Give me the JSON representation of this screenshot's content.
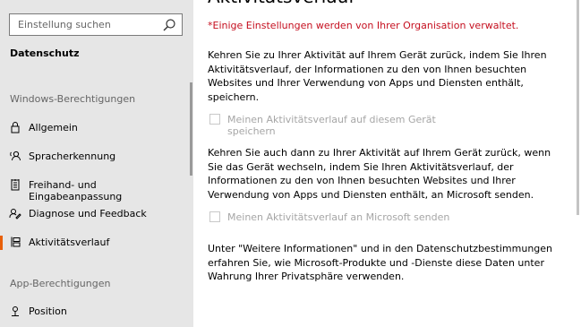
{
  "search": {
    "placeholder": "Einstellung suchen",
    "icon": "search-icon"
  },
  "sidebar": {
    "page_label": "Datenschutz",
    "section_windows": "Windows-Berechtigungen",
    "section_app": "App-Berechtigungen",
    "accent_color": "#e8600a",
    "items": [
      {
        "label": "Allgemein",
        "icon": "lock-icon"
      },
      {
        "label": "Spracherkennung",
        "icon": "speech-icon"
      },
      {
        "label": "Freihand- und Eingabeanpassung",
        "icon": "notepad-icon"
      },
      {
        "label": "Diagnose und Feedback",
        "icon": "feedback-icon"
      },
      {
        "label": "Aktivitätsverlauf",
        "icon": "timeline-icon",
        "active": true
      },
      {
        "label": "Position",
        "icon": "location-icon"
      }
    ]
  },
  "main": {
    "title": "Aktivitätsverlauf",
    "warning": "*Einige Einstellungen werden von Ihrer Organisation verwaltet.",
    "warning_color": "#c50f1f",
    "para1": "Kehren Sie zu Ihrer Aktivität auf Ihrem Gerät zurück, indem Sie Ihren Aktivitätsverlauf, der Informationen zu den von Ihnen besuchten Websites und Ihrer Verwendung von Apps und Diensten enthält, speichern.",
    "checkbox1": {
      "label": "Meinen Aktivitätsverlauf auf diesem Gerät speichern",
      "checked": false,
      "disabled": true
    },
    "para2": "Kehren Sie auch dann zu Ihrer Aktivität auf Ihrem Gerät zurück, wenn Sie das Gerät wechseln, indem Sie Ihren Aktivitätsverlauf, der Informationen zu den von Ihnen besuchten Websites und Ihrer Verwendung von Apps und Diensten enthält, an Microsoft senden.",
    "checkbox2": {
      "label": "Meinen Aktivitätsverlauf an Microsoft senden",
      "checked": false,
      "disabled": true
    },
    "para3": "Unter \"Weitere Informationen\" und in den Datenschutzbestimmungen erfahren Sie, wie Microsoft-Produkte und -Dienste diese Daten unter Wahrung Ihrer Privatsphäre verwenden."
  }
}
